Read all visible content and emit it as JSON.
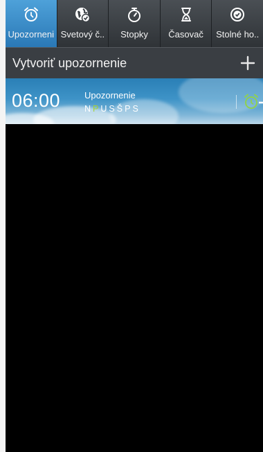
{
  "tabs": [
    {
      "label": "Upozorneni",
      "icon": "alarm-clock-icon",
      "active": true
    },
    {
      "label": "Svetový č..",
      "icon": "world-clock-icon",
      "active": false
    },
    {
      "label": "Stopky",
      "icon": "stopwatch-icon",
      "active": false
    },
    {
      "label": "Časovač",
      "icon": "hourglass-icon",
      "active": false
    },
    {
      "label": "Stolné ho..",
      "icon": "desk-clock-icon",
      "active": false
    }
  ],
  "create_row": {
    "label": "Vytvoriť upozornenie",
    "add_icon": "plus-icon"
  },
  "alarm": {
    "time": "06:00",
    "name": "Upozornenie",
    "days": [
      {
        "letter": "N",
        "on": false
      },
      {
        "letter": "P",
        "on": true
      },
      {
        "letter": "U",
        "on": false
      },
      {
        "letter": "S",
        "on": false
      },
      {
        "letter": "Š",
        "on": false
      },
      {
        "letter": "P",
        "on": false
      },
      {
        "letter": "S",
        "on": false
      }
    ],
    "toggle_icon": "alarm-on-icon"
  },
  "colors": {
    "active_tab": "#3b8ccb",
    "day_on": "#a6d336",
    "alarm_icon_on": "#8fd14f"
  }
}
